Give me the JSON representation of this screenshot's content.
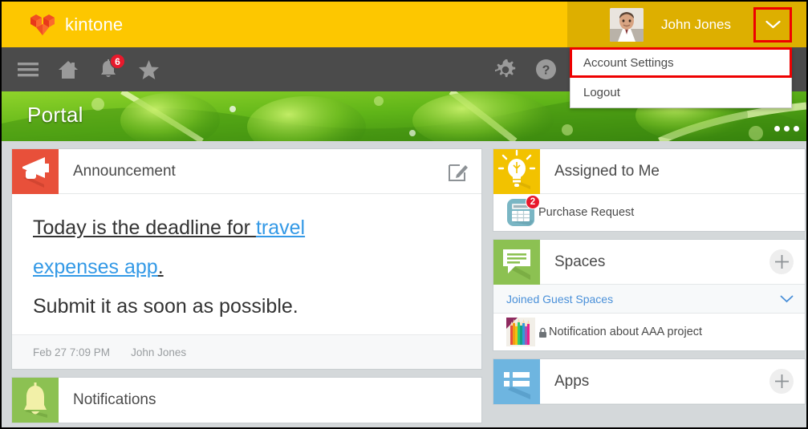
{
  "header": {
    "brand_name": "kintone",
    "logo_icon": "kintone-cube-logo",
    "user_name": "John Jones",
    "avatar_icon": "user-avatar-photo",
    "chevron_icon": "chevron-down-icon",
    "brand_color": "#fdc700",
    "brand_color_shade": "#ddaf00",
    "highlight_color": "#ee0000"
  },
  "account_menu": {
    "items": [
      {
        "label": "Account Settings",
        "highlighted": true
      },
      {
        "label": "Logout",
        "highlighted": false
      }
    ]
  },
  "navbar": {
    "background": "#4b4b4b",
    "left_icons": [
      {
        "name": "hamburger-menu-icon",
        "badge": ""
      },
      {
        "name": "home-icon",
        "badge": ""
      },
      {
        "name": "bell-notification-icon",
        "badge": "6"
      },
      {
        "name": "star-favorites-icon",
        "badge": ""
      }
    ],
    "right_icons": [
      {
        "name": "gear-settings-icon",
        "badge": ""
      },
      {
        "name": "help-question-icon",
        "badge": ""
      }
    ]
  },
  "banner": {
    "title": "Portal",
    "menu_icon": "more-options-dots-icon"
  },
  "announcement": {
    "icon": "megaphone-icon",
    "icon_color": "#e8503a",
    "title": "Announcement",
    "edit_icon": "edit-pencil-icon",
    "line1_prefix": "Today is the deadline for ",
    "line1_link": "travel",
    "line2_link": "expenses app",
    "line2_suffix": ".",
    "line3": "Submit it as soon as possible.",
    "timestamp": "Feb 27 7:09 PM",
    "author": "John Jones"
  },
  "notifications": {
    "icon": "bell-green-icon",
    "icon_color": "#8cc152",
    "title": "Notifications"
  },
  "assigned_to_me": {
    "icon": "lightbulb-icon",
    "icon_color": "#f2c200",
    "title": "Assigned to Me",
    "items": [
      {
        "label": "Purchase Request",
        "badge": "2",
        "icon": "calculator-app-icon"
      }
    ]
  },
  "spaces": {
    "icon": "speech-bubble-icon",
    "icon_color": "#8cc152",
    "title": "Spaces",
    "add_icon": "plus-icon",
    "group_label": "Joined Guest Spaces",
    "group_chevron": "chevron-down-icon",
    "items": [
      {
        "label": "Notification about AAA project",
        "lock_icon": "lock-icon",
        "thumb": "colored-pencils-thumbnail"
      }
    ]
  },
  "apps": {
    "icon": "app-list-icon",
    "icon_color": "#6eb5e0",
    "title": "Apps",
    "add_icon": "plus-icon"
  }
}
